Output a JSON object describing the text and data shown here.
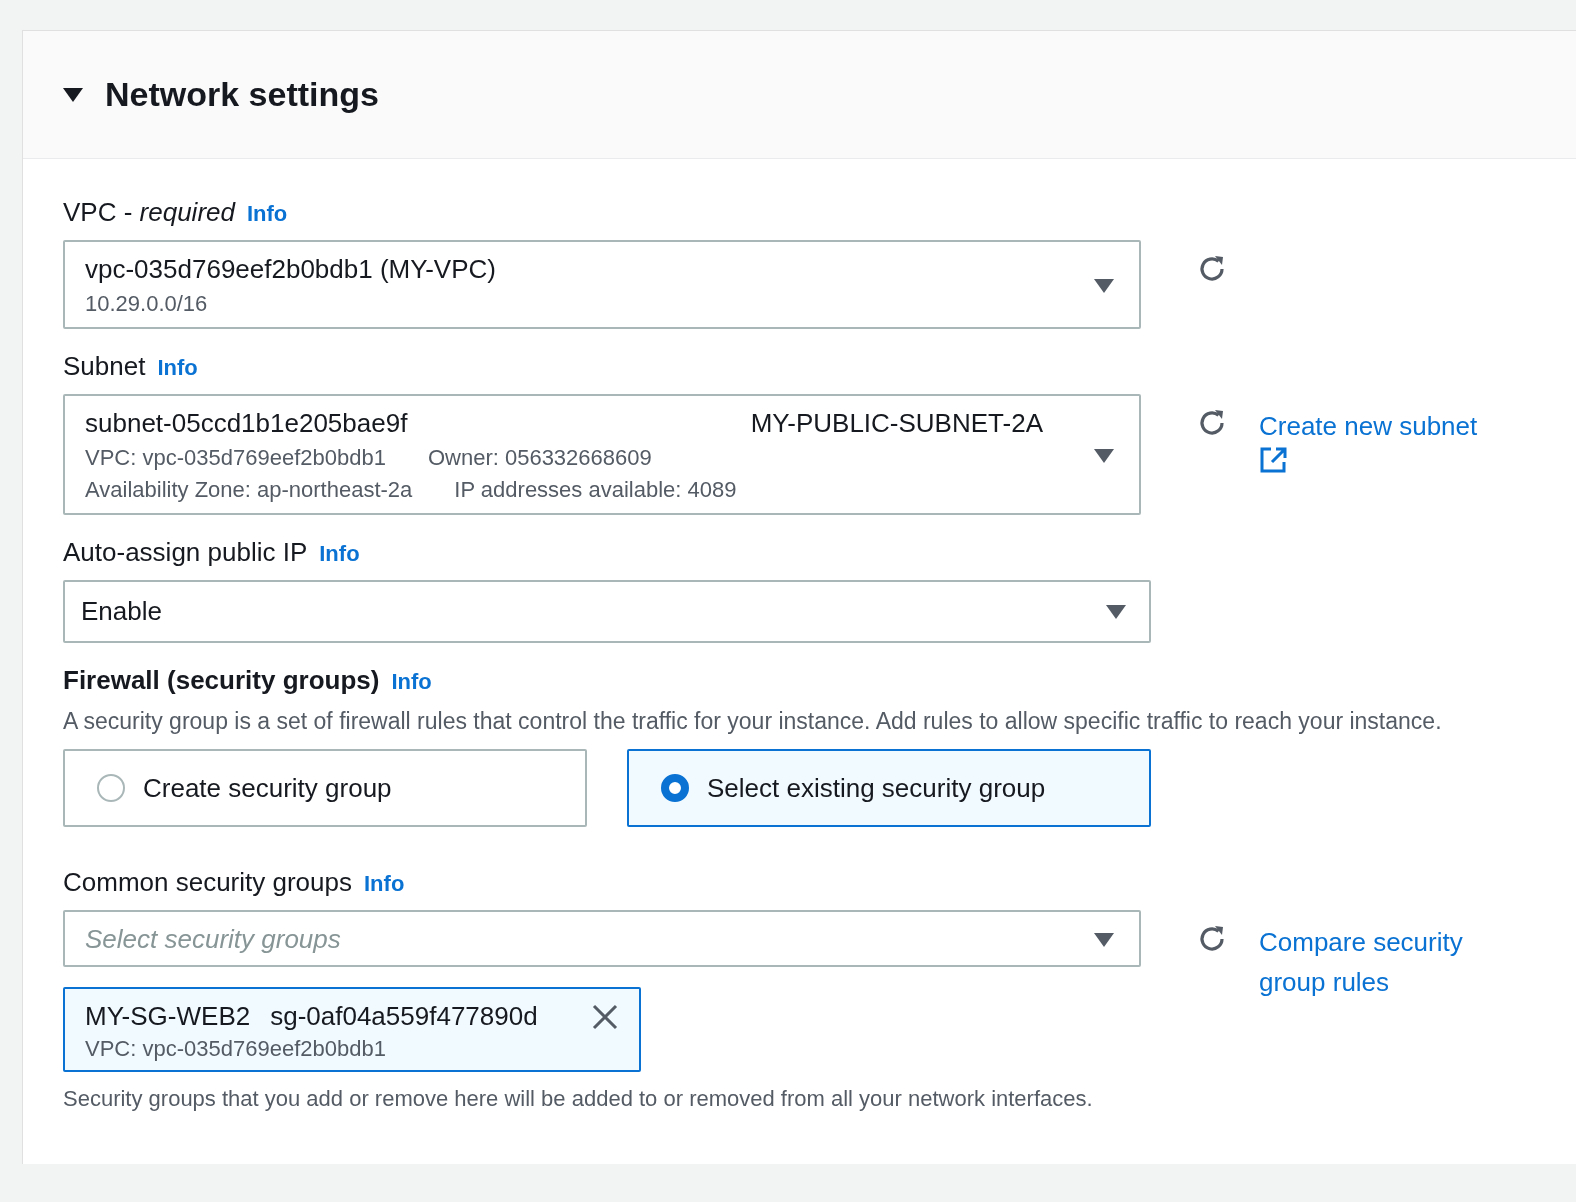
{
  "section": {
    "title": "Network settings",
    "expanded": true
  },
  "fields": [
    {
      "kind": "select",
      "label": "VPC - *required*",
      "info": "Info",
      "value": "vpc-035d769eef2b0bdb1 (MY-VPC)",
      "detail_rows": [
        [
          "10.29.0.0/16"
        ]
      ],
      "refresh": true
    },
    {
      "kind": "select",
      "label": "Subnet",
      "info": "Info",
      "value": "subnet-05ccd1b1e205bae9f",
      "value_right": "MY-PUBLIC-SUBNET-2A",
      "detail_rows": [
        [
          "VPC: vpc-035d769eef2b0bdb1",
          "Owner: 056332668609"
        ],
        [
          "Availability Zone: ap-northeast-2a",
          "IP addresses available: 4089"
        ]
      ],
      "refresh": true,
      "link": {
        "text": "Create new subnet",
        "external": true
      }
    },
    {
      "kind": "select",
      "label": "Auto-assign public IP",
      "info": "Info",
      "value": "Enable",
      "refresh": false
    },
    {
      "kind": "radio",
      "label": "Firewall (security groups)",
      "info": "Info",
      "description": "A security group is a set of firewall rules that control the traffic for your instance. Add rules to allow specific traffic to reach your instance.",
      "options": [
        {
          "label": "Create security group",
          "selected": false
        },
        {
          "label": "Select existing security group",
          "selected": true
        }
      ]
    },
    {
      "kind": "multiselect",
      "label": "Common security groups",
      "info": "Info",
      "placeholder": "Select security groups",
      "refresh": true,
      "link": {
        "text": "Compare security group rules",
        "external": false
      },
      "tokens": [
        {
          "name": "MY-SG-WEB2",
          "id": "sg-0af04a559f477890d",
          "detail": "VPC: vpc-035d769eef2b0bdb1"
        }
      ],
      "help": "Security groups that you add or remove here will be added to or removed from all your network interfaces."
    }
  ]
}
